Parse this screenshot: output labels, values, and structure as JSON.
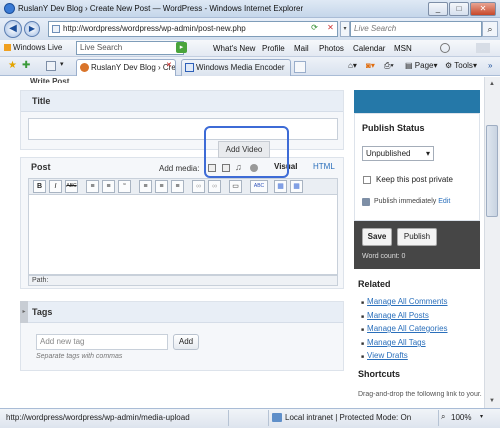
{
  "window": {
    "title": "RuslanY Dev Blog › Create New Post — WordPress - Windows Internet Explorer"
  },
  "address_bar": {
    "url": "http://wordpress/wordpress/wp-admin/post-new.php",
    "search_placeholder": "Live Search"
  },
  "links_toolbar": {
    "windows_live": "Windows Live",
    "search_placeholder": "Live Search",
    "links": [
      "What's New",
      "Profile",
      "Mail",
      "Photos",
      "Calendar",
      "MSN"
    ]
  },
  "tabs": [
    {
      "label": "RuslanY Dev Blog › Cre..."
    },
    {
      "label": "Windows Media Encoder"
    }
  ],
  "command_bar": {
    "page": "Page",
    "tools": "Tools"
  },
  "editor": {
    "partial_heading": "Write Post",
    "title_label": "Title",
    "post_label": "Post",
    "add_media_label": "Add media:",
    "visual_tab": "Visual",
    "html_tab": "HTML",
    "path_label": "Path:",
    "toolbar_buttons": [
      "B",
      "I",
      "ABC",
      "≡",
      "≡",
      "“",
      "≡",
      "≡",
      "≡",
      "∞",
      "∞",
      "▭",
      "ABC",
      "▦",
      "▦"
    ]
  },
  "popup": {
    "tooltip": "Add Video"
  },
  "tags": {
    "label": "Tags",
    "input_placeholder": "Add new tag",
    "add_button": "Add",
    "hint": "Separate tags with commas"
  },
  "publish": {
    "heading": "Publish Status",
    "status_selected": "Unpublished",
    "private_label": "Keep this post private",
    "publish_immediately": "Publish immediately",
    "edit_link": "Edit",
    "save_button": "Save",
    "publish_button": "Publish",
    "word_count": "Word count: 0"
  },
  "related": {
    "heading": "Related",
    "items": [
      "Manage All Comments",
      "Manage All Posts",
      "Manage All Categories",
      "Manage All Tags",
      "View Drafts"
    ]
  },
  "shortcuts": {
    "heading": "Shortcuts",
    "text": "Drag-and-drop the following link to your..."
  },
  "status_bar": {
    "url": "http://wordpress/wordpress/wp-admin/media-upload",
    "zone": "Local intranet | Protected Mode: On",
    "zoom": "100%"
  },
  "colors": {
    "publish_bar": "#2578a8",
    "action_panel": "#464646",
    "popup_border": "#3d6bd6",
    "link": "#2a6fbb"
  }
}
